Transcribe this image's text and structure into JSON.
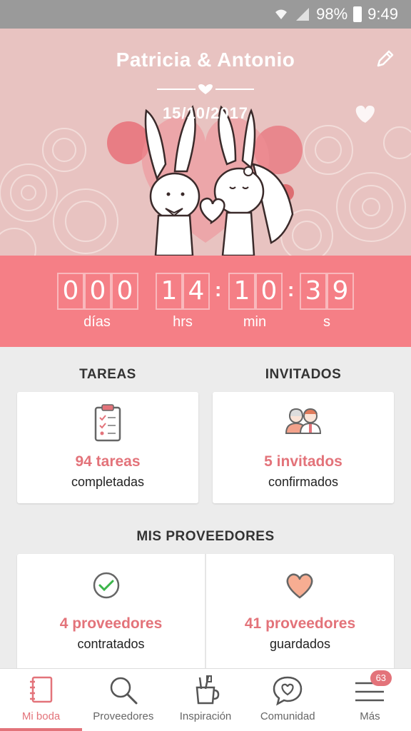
{
  "status_bar": {
    "battery": "98%",
    "time": "9:49"
  },
  "header": {
    "couple_names": "Patricia & Antonio",
    "date": "15/10/2017"
  },
  "countdown": {
    "days_digits": [
      "0",
      "0",
      "0"
    ],
    "hours_digits": [
      "1",
      "4"
    ],
    "minutes_digits": [
      "1",
      "0"
    ],
    "seconds_digits": [
      "3",
      "9"
    ],
    "days_label": "días",
    "hours_label": "hrs",
    "minutes_label": "min",
    "seconds_label": "s"
  },
  "tasks": {
    "title": "TAREAS",
    "count": "94 tareas",
    "caption": "completadas"
  },
  "guests": {
    "title": "INVITADOS",
    "count": "5 invitados",
    "caption": "confirmados"
  },
  "providers": {
    "title": "MIS PROVEEDORES",
    "hired_count": "4 proveedores",
    "hired_caption": "contratados",
    "saved_count": "41 proveedores",
    "saved_caption": "guardados"
  },
  "nav": {
    "items": [
      {
        "label": "Mi boda",
        "icon": "notebook-icon"
      },
      {
        "label": "Proveedores",
        "icon": "search-icon"
      },
      {
        "label": "Inspiración",
        "icon": "brush-cup-icon"
      },
      {
        "label": "Comunidad",
        "icon": "chat-heart-icon"
      },
      {
        "label": "Más",
        "icon": "menu-icon"
      }
    ],
    "more_badge": "63"
  },
  "colors": {
    "accent": "#e3737a",
    "countdown_bg": "#f57f86",
    "hero_bg": "#e8c3c1"
  }
}
